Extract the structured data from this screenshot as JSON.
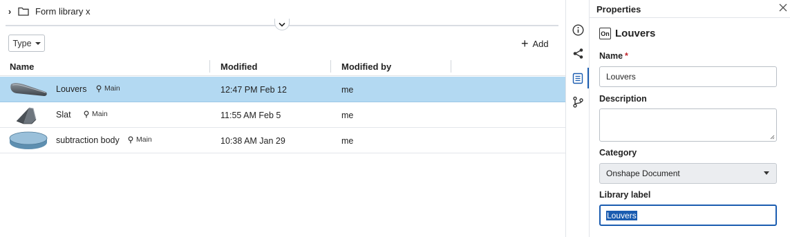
{
  "breadcrumb": {
    "folder_name": "Form library x"
  },
  "toolbar": {
    "type_label": "Type",
    "add_label": "Add"
  },
  "table": {
    "columns": [
      "Name",
      "Modified",
      "Modified by"
    ],
    "rows": [
      {
        "name": "Louvers",
        "branch": "Main",
        "modified": "12:47 PM Feb 12",
        "modified_by": "me",
        "selected": true,
        "thumb": "louvers-thumbnail"
      },
      {
        "name": "Slat",
        "branch": "Main",
        "modified": "11:55 AM Feb 5",
        "modified_by": "me",
        "selected": false,
        "thumb": "slat-thumbnail"
      },
      {
        "name": "subtraction body",
        "branch": "Main",
        "modified": "10:38 AM Jan 29",
        "modified_by": "me",
        "selected": false,
        "thumb": "subtraction-body-thumbnail"
      }
    ]
  },
  "rail": {
    "icons": [
      "info-icon",
      "share-icon",
      "properties-icon",
      "branch-icon"
    ],
    "active": "properties-icon"
  },
  "properties": {
    "title": "Properties",
    "doc_badge": "On",
    "doc_name": "Louvers",
    "name_label": "Name",
    "required_mark": "*",
    "name_value": "Louvers",
    "description_label": "Description",
    "description_value": "",
    "category_label": "Category",
    "category_value": "Onshape Document",
    "library_label_label": "Library label",
    "library_label_value": "Louvers"
  },
  "colors": {
    "selected_row": "#b3d9f2",
    "accent": "#1a5cb0",
    "required": "#c0262d"
  }
}
